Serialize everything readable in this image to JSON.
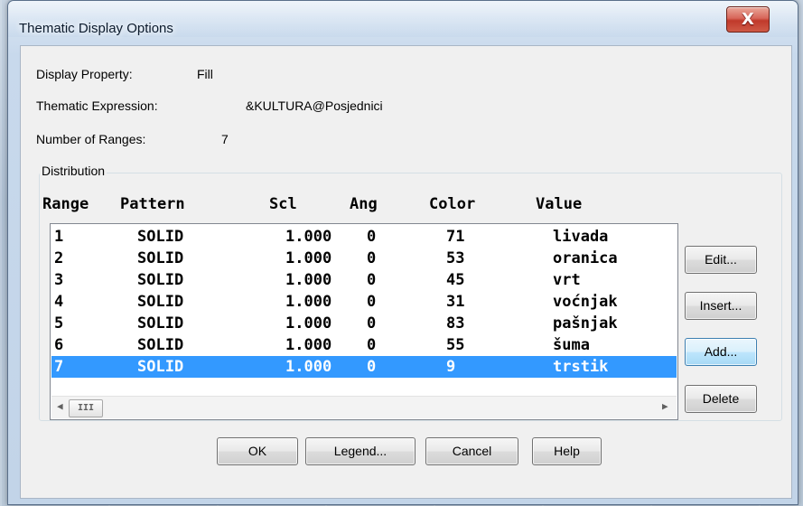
{
  "window": {
    "title": "Thematic Display Options",
    "close_glyph": "X"
  },
  "display_property": {
    "label": "Display Property:",
    "value": "Fill"
  },
  "thematic_expression": {
    "label": "Thematic Expression:",
    "value": "&KULTURA@Posjednici"
  },
  "number_of_ranges": {
    "label": "Number of Ranges:",
    "value": "7"
  },
  "distribution": {
    "caption": "Distribution",
    "columns": [
      "Range",
      "Pattern",
      "Scl",
      "Ang",
      "Color",
      "Value"
    ],
    "rows": [
      [
        "1",
        "SOLID",
        "1.000",
        "0",
        "71",
        "livada"
      ],
      [
        "2",
        "SOLID",
        "1.000",
        "0",
        "53",
        "oranica"
      ],
      [
        "3",
        "SOLID",
        "1.000",
        "0",
        "45",
        "vrt"
      ],
      [
        "4",
        "SOLID",
        "1.000",
        "0",
        "31",
        "voćnjak"
      ],
      [
        "5",
        "SOLID",
        "1.000",
        "0",
        "83",
        "pašnjak"
      ],
      [
        "6",
        "SOLID",
        "1.000",
        "0",
        "55",
        "šuma"
      ],
      [
        "7",
        "SOLID",
        "1.000",
        "0",
        "9",
        "trstik"
      ]
    ],
    "selected_row": "7",
    "scroll_left_glyph": "◀",
    "scroll_right_glyph": "▶",
    "scroll_thumb_glyph": "III"
  },
  "side_buttons": {
    "edit": "Edit...",
    "insert": "Insert...",
    "add": "Add...",
    "delete": "Delete"
  },
  "bottom_buttons": {
    "ok": "OK",
    "legend": "Legend...",
    "cancel": "Cancel",
    "help": "Help"
  },
  "colors": {
    "selection": "#3399ff",
    "close_button": "#c0392b"
  },
  "icons": {
    "close": "close-icon",
    "scroll_left": "chevron-left-icon",
    "scroll_right": "chevron-right-icon"
  }
}
